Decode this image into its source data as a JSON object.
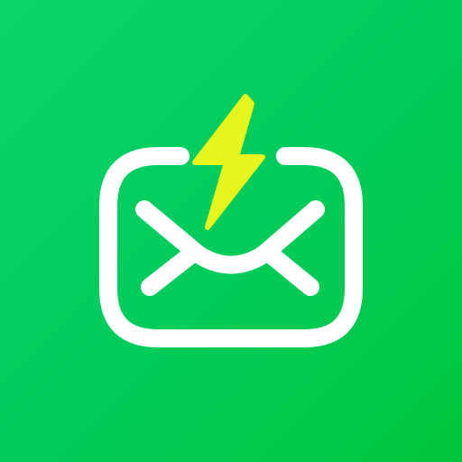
{
  "app_icon": {
    "icons": {
      "envelope": "envelope-icon",
      "bolt": "lightning-bolt-icon"
    },
    "colors": {
      "background_start": "#08d46a",
      "background_end": "#00c63c",
      "envelope_stroke": "#ffffff",
      "bolt_fill": "#e8f51c"
    }
  }
}
